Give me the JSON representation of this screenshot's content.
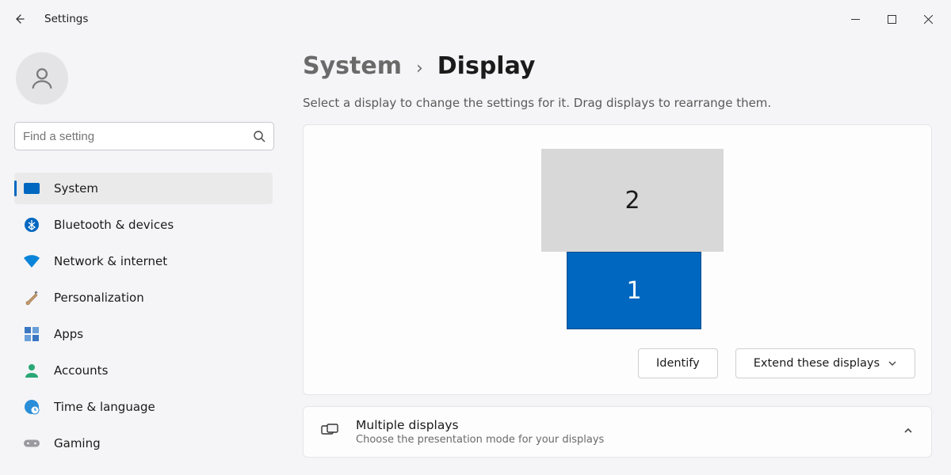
{
  "window": {
    "app_title": "Settings"
  },
  "search": {
    "placeholder": "Find a setting"
  },
  "sidebar": {
    "items": [
      {
        "label": "System"
      },
      {
        "label": "Bluetooth & devices"
      },
      {
        "label": "Network & internet"
      },
      {
        "label": "Personalization"
      },
      {
        "label": "Apps"
      },
      {
        "label": "Accounts"
      },
      {
        "label": "Time & language"
      },
      {
        "label": "Gaming"
      }
    ]
  },
  "breadcrumb": {
    "parent": "System",
    "separator": "›",
    "current": "Display"
  },
  "subtitle": "Select a display to change the settings for it. Drag displays to rearrange them.",
  "arrangement": {
    "display1_label": "1",
    "display2_label": "2"
  },
  "buttons": {
    "identify": "Identify",
    "mode": "Extend these displays"
  },
  "section_multiple": {
    "title": "Multiple displays",
    "subtitle": "Choose the presentation mode for your displays"
  }
}
